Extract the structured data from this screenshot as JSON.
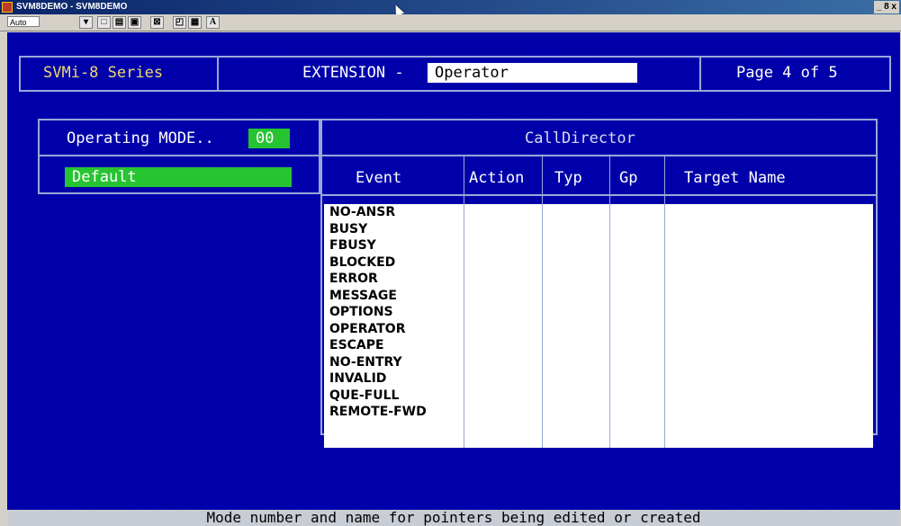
{
  "window": {
    "title": "SVM8DEMO - SVM8DEMO",
    "controls": "_ 8 x"
  },
  "toolbar": {
    "auto_label": "Auto",
    "font_button": "A"
  },
  "header": {
    "series": "SVMi-8 Series",
    "extension_label": "EXTENSION -",
    "extension_value": "Operator",
    "page": "Page 4 of 5"
  },
  "mode": {
    "label": "Operating MODE..",
    "value": "00",
    "name": "Default"
  },
  "calldirector": {
    "title": "CallDirector",
    "columns": [
      "Event",
      "Action",
      "Typ",
      "Gp",
      "Target Name"
    ],
    "events": [
      "NO-ANSR",
      "BUSY",
      "FBUSY",
      "BLOCKED",
      "ERROR",
      "MESSAGE",
      "OPTIONS",
      "OPERATOR",
      "ESCAPE",
      "NO-ENTRY",
      "INVALID",
      "QUE-FULL",
      "REMOTE-FWD"
    ]
  },
  "status": "Mode number and name for pointers being edited or created",
  "colors": {
    "background": "#0000a8",
    "field_green": "#27c432",
    "border": "#9aa7d8",
    "label_gold": "#f0d870"
  }
}
